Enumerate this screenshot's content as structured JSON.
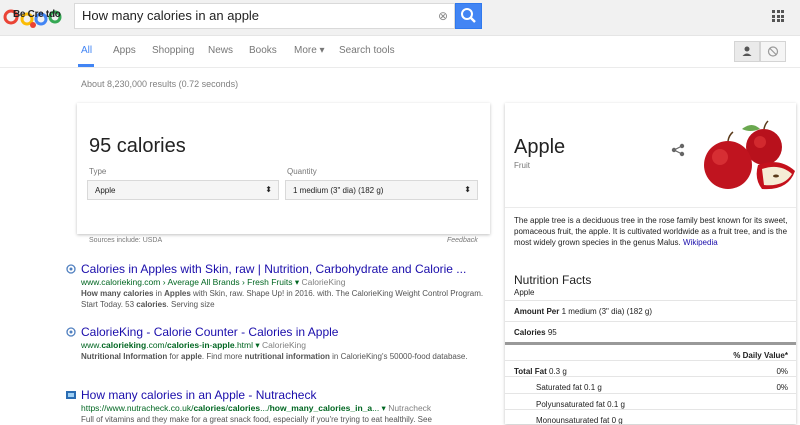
{
  "logo": {
    "text": "Be Cre tdo"
  },
  "search": {
    "query": "How many calories in an apple"
  },
  "tabs": [
    {
      "label": "All"
    },
    {
      "label": "Apps"
    },
    {
      "label": "Shopping"
    },
    {
      "label": "News"
    },
    {
      "label": "Books"
    },
    {
      "label": "More ▾"
    },
    {
      "label": "Search tools"
    }
  ],
  "stats": "About 8,230,000 results (0.72 seconds)",
  "answer": {
    "value": "95 calories",
    "type_label": "Type",
    "type_value": "Apple",
    "quantity_label": "Quantity",
    "quantity_value": "1 medium (3\" dia) (182 g)",
    "sources": "Sources include: USDA",
    "feedback": "Feedback"
  },
  "results": [
    {
      "title": "Calories in Apples with Skin, raw | Nutrition, Carbohydrate and Calorie ...",
      "url_html": "www.calorieking.com › Average All Brands › Fresh Fruits ▾",
      "source": "CalorieKing",
      "snippet_html": "<b>How many calories</b> in <b>Apples</b> with Skin, raw. Shape Up! in 2016. with. The CalorieKing Weight Control Program. Start Today. 53 <b>calories</b>. Serving size"
    },
    {
      "title": "CalorieKing - Calorie Counter - Calories in Apple",
      "url_html": "www.<b>calorieking</b>.com/<b>calories</b>-<b>in</b>-<b>apple</b>.html ▾",
      "source": "CalorieKing",
      "snippet_html": "<b>Nutritional Information</b> for <b>apple</b>. Find more <b>nutritional information</b> in CalorieKing's 50000-food database."
    },
    {
      "title": "How many calories in an Apple - Nutracheck",
      "url_html": "https://www.nutracheck.co.uk/<b>calories</b>/<b>calories</b>.../<b>how_many_calories_in_a</b>... ▾",
      "source": "Nutracheck",
      "snippet_html": "Full of vitamins and they make for a great snack food, especially if you're trying to eat healthily. See"
    }
  ],
  "knowledge": {
    "title": "Apple",
    "subtitle": "Fruit",
    "description": "The apple tree is a deciduous tree in the rose family best known for its sweet, pomaceous fruit, the apple. It is cultivated worldwide as a fruit tree, and is the most widely grown species in the genus Malus.",
    "description_link": "Wikipedia",
    "nutrition_title": "Nutrition Facts",
    "nutrition_subtitle": "Apple",
    "amount_label": "Amount Per",
    "amount_value": "1 medium (3\" dia) (182 g)",
    "calories_label": "Calories",
    "calories_value": "95",
    "dv_header": "% Daily Value*",
    "rows": [
      {
        "label": "Total Fat",
        "value": "0.3 g",
        "dv": "0%"
      },
      {
        "label": "Saturated fat",
        "value": "0.1 g",
        "dv": "0%"
      },
      {
        "label": "Polyunsaturated fat",
        "value": "0.1 g",
        "dv": ""
      },
      {
        "label": "Monounsaturated fat",
        "value": "0 g",
        "dv": ""
      }
    ]
  },
  "colors": {
    "accent": "#4285f4",
    "link": "#1a0dab",
    "url": "#006621"
  }
}
